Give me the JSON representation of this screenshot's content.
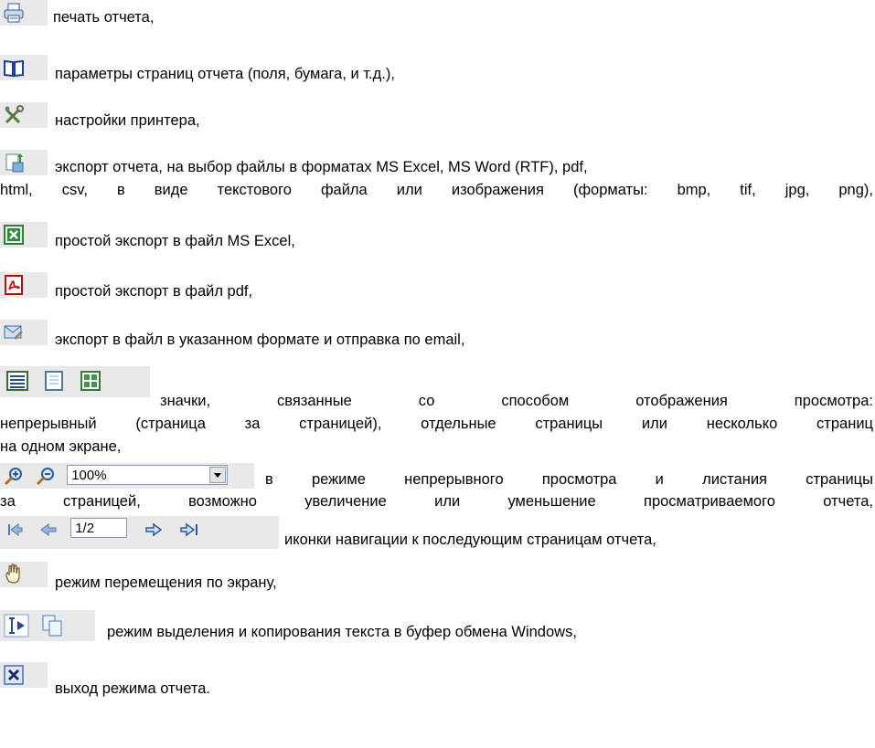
{
  "items": [
    {
      "icon": "printer-icon",
      "text": "печать отчета,"
    },
    {
      "icon": "page-setup-book-icon",
      "text": "параметры страниц отчета (поля, бумага, и т.д.),"
    },
    {
      "icon": "printer-settings-tools-icon",
      "text": "настройки принтера,"
    },
    {
      "icon": "export-icon",
      "lines": [
        "экспорт отчета, на выбор файлы в форматах MS Excel, MS Word (RTF), pdf,",
        "html, csv, в виде текстового файла или изображения (форматы: bmp, tif, jpg, png),"
      ]
    },
    {
      "icon": "excel-export-icon",
      "text": "простой экспорт в файл MS Excel,"
    },
    {
      "icon": "pdf-export-icon",
      "text": "простой экспорт в файл pdf,"
    },
    {
      "icon": "email-export-icon",
      "text": "экспорт в файл в указанном формате и отправка по email,"
    },
    {
      "icons": [
        "continuous-view-icon",
        "single-page-view-icon",
        "multi-page-view-icon"
      ],
      "lines": [
        "значки, связанные со способом отображения просмотра:",
        "непрерывный (страница за страницей), отдельные страницы или несколько страниц",
        "на одном экране,"
      ]
    },
    {
      "icons": [
        "zoom-in-icon",
        "zoom-out-icon"
      ],
      "zoom_value": "100%",
      "lines": [
        "в режиме непрерывного просмотра и листания страницы",
        "за страницей, возможно увеличение или уменьшение просматриваемого отчета,"
      ]
    },
    {
      "icons": [
        "first-page-icon",
        "prev-page-icon",
        "next-page-icon",
        "last-page-icon"
      ],
      "page_value": "1/2",
      "text": "иконки навигации к последующим страницам отчета,"
    },
    {
      "icon": "hand-pan-icon",
      "text": "режим перемещения по экрану,"
    },
    {
      "icons": [
        "text-select-icon",
        "copy-icon"
      ],
      "text": "режим выделения и копирования текста в буфер обмена Windows,"
    },
    {
      "icon": "close-report-icon",
      "text": "выход режима отчета."
    }
  ]
}
